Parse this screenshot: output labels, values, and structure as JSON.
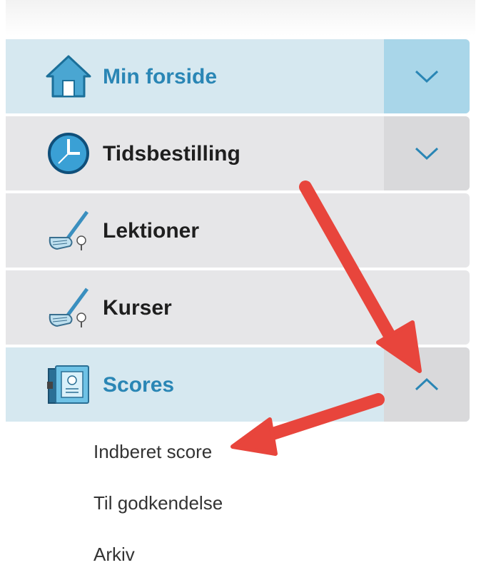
{
  "menu": {
    "items": [
      {
        "label": "Min forside",
        "icon": "home-icon",
        "expandable": true,
        "expanded": false,
        "active": true
      },
      {
        "label": "Tidsbestilling",
        "icon": "clock-icon",
        "expandable": true,
        "expanded": false,
        "active": false
      },
      {
        "label": "Lektioner",
        "icon": "golf-club-icon",
        "expandable": false,
        "active": false
      },
      {
        "label": "Kurser",
        "icon": "golf-club-icon",
        "expandable": false,
        "active": false
      },
      {
        "label": "Scores",
        "icon": "scorecard-icon",
        "expandable": true,
        "expanded": true,
        "active": true
      }
    ],
    "submenu": [
      {
        "label": "Indberet score"
      },
      {
        "label": "Til godkendelse"
      },
      {
        "label": "Arkiv"
      }
    ]
  },
  "colors": {
    "accent": "#2a86b5",
    "active_bg": "#d6e8f0",
    "toggle_active_bg": "#a9d6e9",
    "item_bg": "#e6e6e8",
    "annotation_arrow": "#e8453c"
  }
}
